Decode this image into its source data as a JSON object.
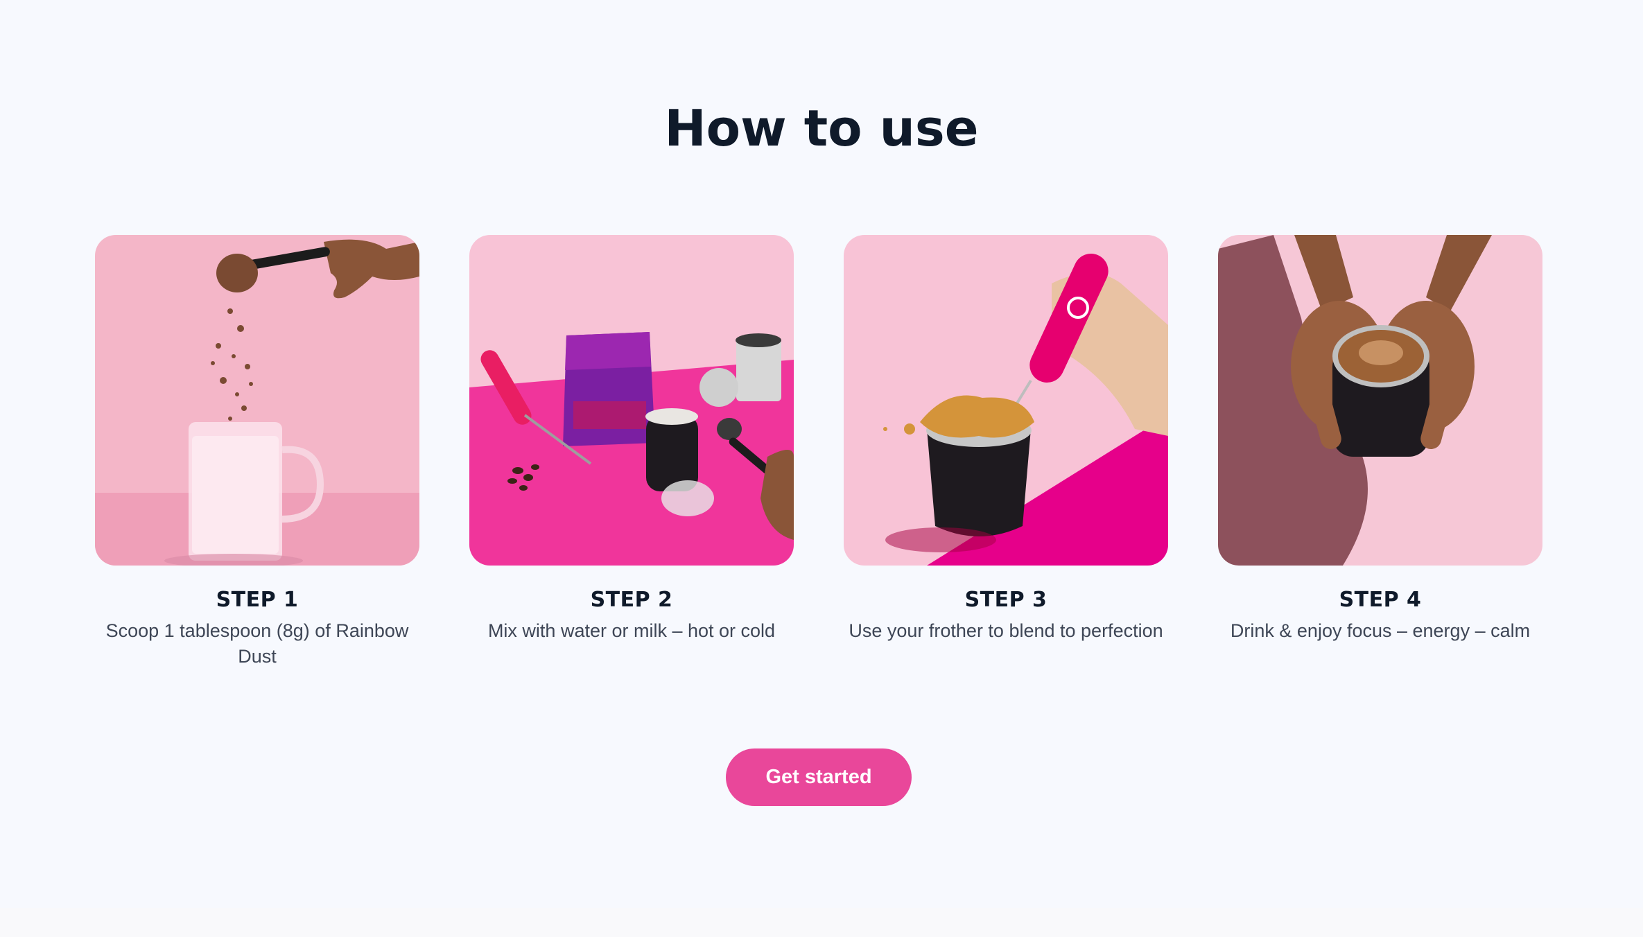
{
  "section": {
    "title": "How to use"
  },
  "steps": [
    {
      "label": "STEP 1",
      "description": "Scoop 1 tablespoon (8g) of Rainbow Dust"
    },
    {
      "label": "STEP 2",
      "description": "Mix with water or milk – hot or cold"
    },
    {
      "label": "STEP 3",
      "description": "Use your frother to blend to perfection"
    },
    {
      "label": "STEP 4",
      "description": "Drink & enjoy focus – energy – calm"
    }
  ],
  "cta": {
    "label": "Get started"
  },
  "colors": {
    "background": "#f7f9fe",
    "accent": "#e9479a",
    "heading": "#0f1a2a",
    "body_text": "#3e4656",
    "photo_pink": "#f4b3c8",
    "photo_magenta": "#f0359b"
  },
  "images": [
    {
      "name": "scoop-powder-into-glass-photo"
    },
    {
      "name": "product-pouch-frother-cup-photo"
    },
    {
      "name": "frothing-in-cup-photo"
    },
    {
      "name": "hands-holding-cup-photo"
    }
  ]
}
